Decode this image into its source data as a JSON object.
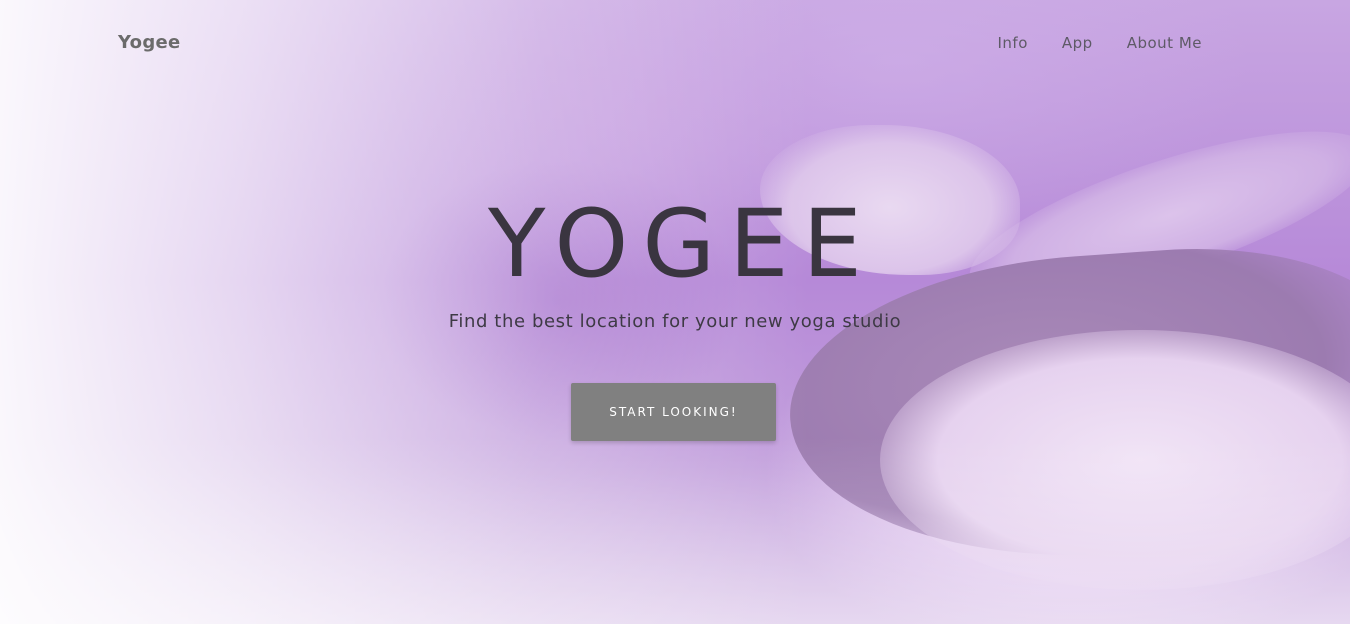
{
  "navbar": {
    "brand": "Yogee",
    "links": [
      {
        "label": "Info"
      },
      {
        "label": "App"
      },
      {
        "label": "About Me"
      }
    ]
  },
  "hero": {
    "title": "YOGEE",
    "subtitle": "Find the best location for your new yoga studio",
    "cta_label": "START LOOKING!",
    "background": "yoga-meditation-photo"
  },
  "colors": {
    "overlay_purple": "#b07fd3",
    "button_bg": "#808080",
    "title_text": "#3a3540",
    "nav_text": "#5e5a66"
  }
}
